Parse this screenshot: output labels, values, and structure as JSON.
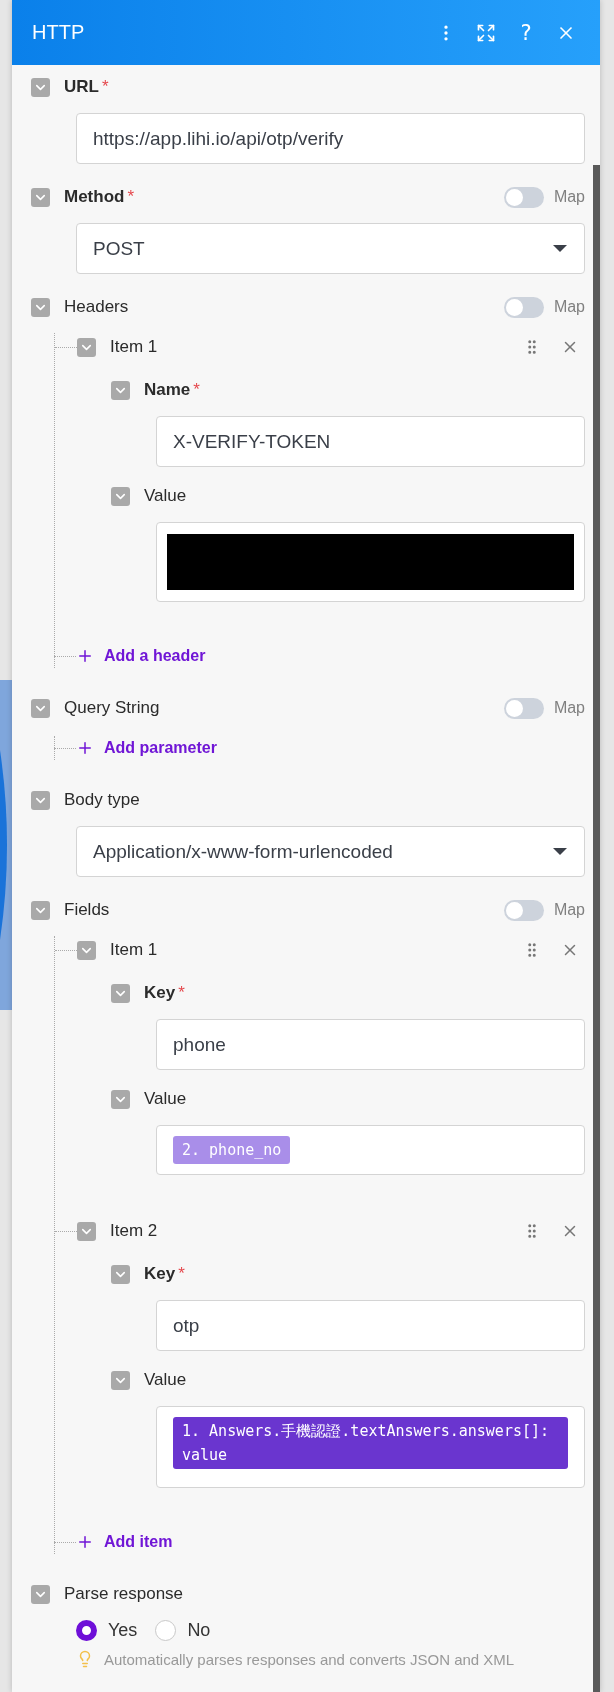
{
  "header": {
    "title": "HTTP",
    "help": "?"
  },
  "sections": [
    {
      "kind": "input",
      "label": "URL",
      "required_mark": "*",
      "value": "https://app.lihi.io/api/otp/verify"
    },
    {
      "kind": "select",
      "label": "Method",
      "required_mark": "*",
      "map": {
        "label": "Map",
        "on": false
      },
      "value": "POST"
    },
    {
      "kind": "array",
      "label": "Headers",
      "map": {
        "label": "Map",
        "on": false
      },
      "items": [
        {
          "title": "Item 1",
          "fields": [
            {
              "kind": "input",
              "label": "Name",
              "required_mark": "*",
              "value": "X-VERIFY-TOKEN"
            },
            {
              "kind": "redacted",
              "label": "Value"
            }
          ]
        }
      ],
      "add": "Add a header"
    },
    {
      "kind": "array",
      "label": "Query String",
      "map": {
        "label": "Map",
        "on": false
      },
      "add": "Add parameter"
    },
    {
      "kind": "select",
      "label": "Body type",
      "value": "Application/x-www-form-urlencoded"
    },
    {
      "kind": "array",
      "label": "Fields",
      "map": {
        "label": "Map",
        "on": false
      },
      "items": [
        {
          "title": "Item 1",
          "fields": [
            {
              "kind": "input",
              "label": "Key",
              "required_mark": "*",
              "value": "phone"
            },
            {
              "kind": "tokens",
              "label": "Value",
              "tokens": [
                {
                  "text": "2. phone_no",
                  "color": "#a98ee9"
                }
              ]
            }
          ]
        },
        {
          "title": "Item 2",
          "fields": [
            {
              "kind": "input",
              "label": "Key",
              "required_mark": "*",
              "value": "otp"
            },
            {
              "kind": "tokens",
              "label": "Value",
              "tokens": [
                {
                  "text": "1. Answers.手機認證.textAnswers.answers[]: value",
                  "color": "#6a35cf"
                }
              ]
            }
          ]
        }
      ],
      "add": "Add item"
    },
    {
      "kind": "radio",
      "label": "Parse response",
      "options": [
        {
          "label": "Yes",
          "selected": true
        },
        {
          "label": "No",
          "selected": false
        }
      ],
      "hint": "Automatically parses responses and converts JSON and XML"
    }
  ]
}
